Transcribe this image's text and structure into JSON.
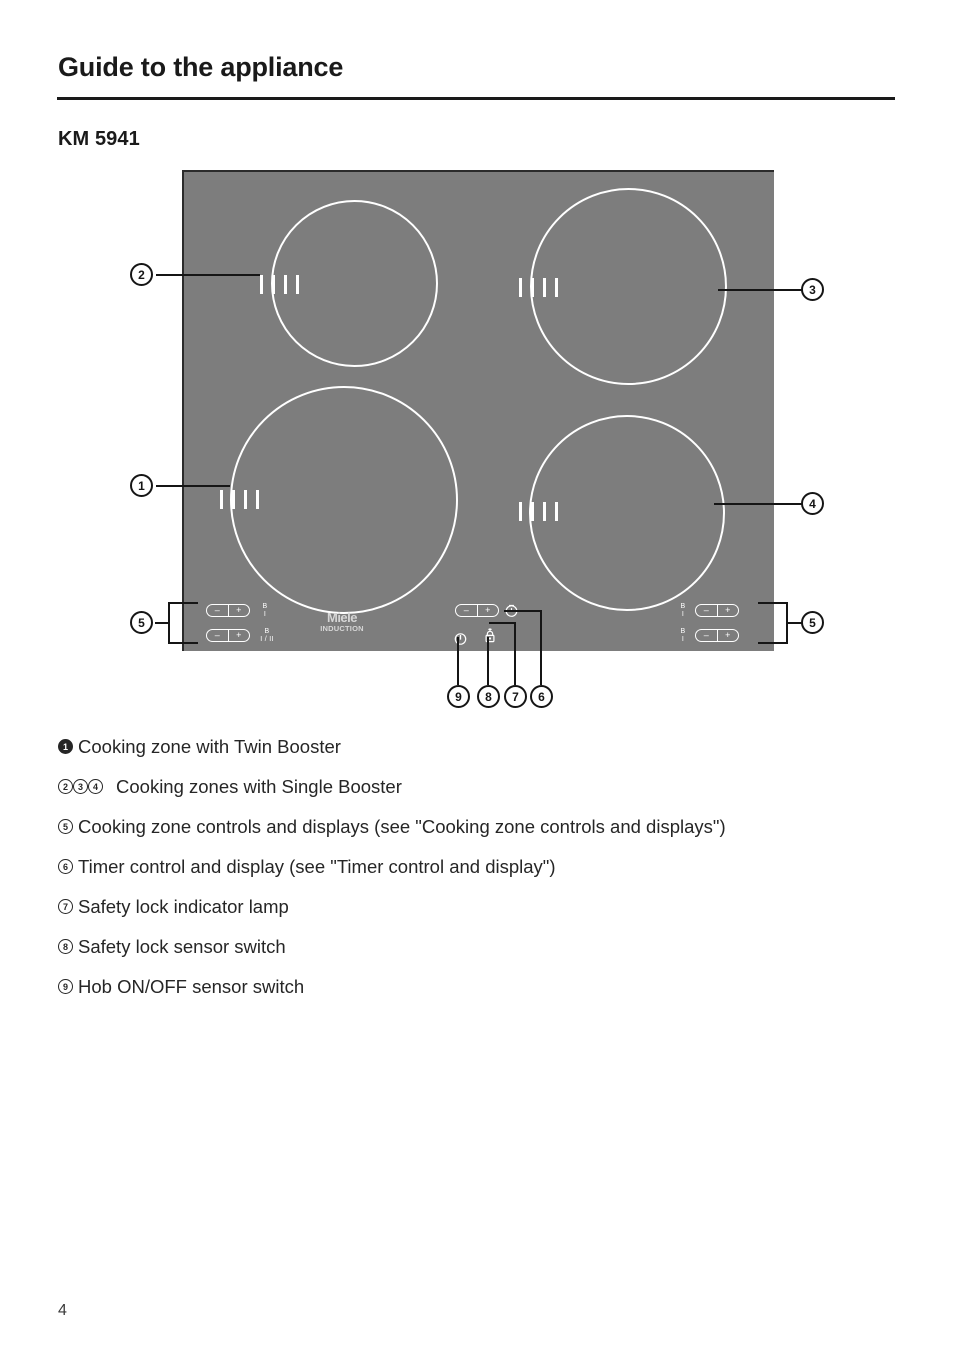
{
  "header": {
    "title": "Guide to the appliance",
    "model": "KM 5941"
  },
  "hob": {
    "brand_name": "Miele",
    "brand_sub": "INDUCTION",
    "zones": [
      {
        "id": "top-left",
        "callout": "2",
        "ticks": 4
      },
      {
        "id": "top-right",
        "callout": "3",
        "ticks": 4
      },
      {
        "id": "bottom-left",
        "callout": "1",
        "ticks": 4
      },
      {
        "id": "bottom-right",
        "callout": "4",
        "ticks": 4
      }
    ],
    "controls": {
      "minus_symbol": "–",
      "plus_symbol": "+",
      "left_labels": [
        "B\nI",
        "B\nI / II"
      ],
      "right_labels": [
        "B\nI",
        "B\nI"
      ],
      "timer_icon": "timer-clock-icon",
      "power_icon": "power-onoff-icon",
      "lock_icon": "safety-lock-icon",
      "lock_lamp_icon": "safety-lock-indicator-lamp"
    }
  },
  "callouts": {
    "left_top": "2",
    "left_mid": "1",
    "left_bottom": "5",
    "right_top": "3",
    "right_mid": "4",
    "right_bottom": "5",
    "bottom_row": [
      "9",
      "8",
      "7",
      "6"
    ]
  },
  "legend": [
    {
      "marks": [
        "1"
      ],
      "filled": true,
      "text": "Cooking zone with Twin Booster"
    },
    {
      "marks": [
        "2",
        "3",
        "4"
      ],
      "filled": false,
      "text": "Cooking zones with Single Booster"
    },
    {
      "marks": [
        "5"
      ],
      "filled": false,
      "text": "Cooking zone controls and displays (see \"Cooking zone controls and displays\")"
    },
    {
      "marks": [
        "6"
      ],
      "filled": false,
      "text": "Timer control and display (see \"Timer control and display\")"
    },
    {
      "marks": [
        "7"
      ],
      "filled": false,
      "text": "Safety lock indicator lamp"
    },
    {
      "marks": [
        "8"
      ],
      "filled": false,
      "text": "Safety lock sensor switch"
    },
    {
      "marks": [
        "9"
      ],
      "filled": false,
      "text": "Hob ON/OFF sensor switch"
    }
  ],
  "footer": {
    "page_number": "4"
  }
}
